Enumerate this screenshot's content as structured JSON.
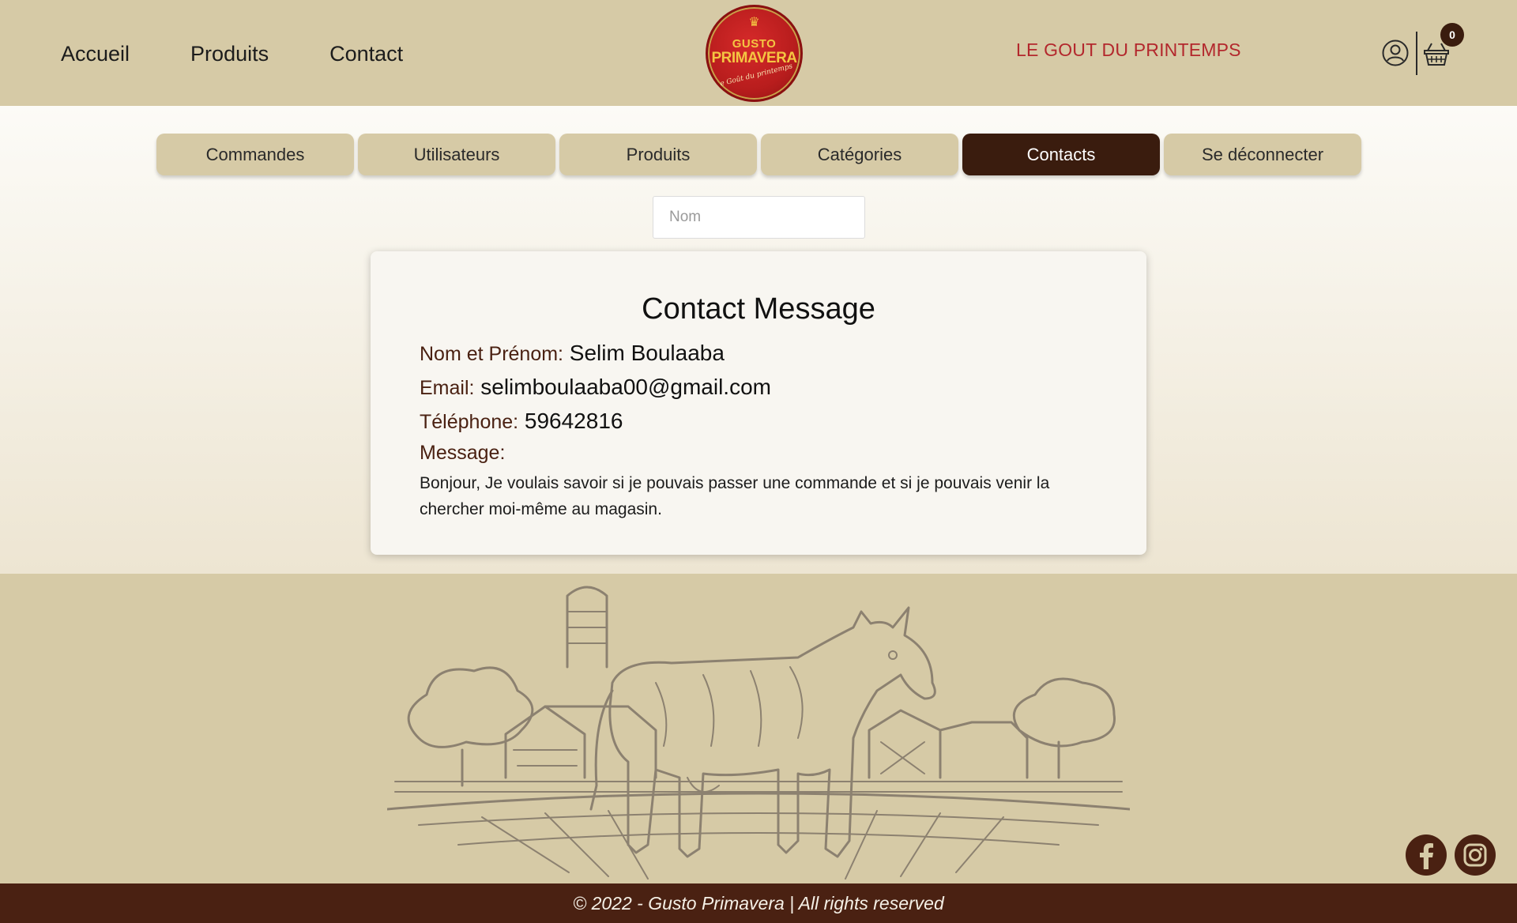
{
  "header": {
    "nav": [
      "Accueil",
      "Produits",
      "Contact"
    ],
    "logo": {
      "top": "GUSTO",
      "main": "PRIMAVERA",
      "sub": "Le Goût du printemps"
    },
    "tagline": "LE GOUT DU PRINTEMPS",
    "cart_count": "0",
    "icons": [
      "user-icon",
      "basket-icon"
    ],
    "tagline_color": "#b3282d"
  },
  "admin_tabs": {
    "items": [
      "Commandes",
      "Utilisateurs",
      "Produits",
      "Catégories",
      "Contacts",
      "Se déconnecter"
    ],
    "active": "Contacts"
  },
  "search": {
    "placeholder": "Nom",
    "value": ""
  },
  "contact_card": {
    "title": "Contact Message",
    "name_label": "Nom et Prénom:",
    "name_value": "Selim Boulaaba",
    "email_label": "Email:",
    "email_value": "selimboulaaba00@gmail.com",
    "phone_label": "Téléphone:",
    "phone_value": "59642816",
    "message_label": "Message:",
    "message_text": "Bonjour, Je voulais savoir si je pouvais passer une commande et si je pouvais venir la chercher moi-même au magasin."
  },
  "footer": {
    "social": [
      "facebook-icon",
      "instagram-icon"
    ],
    "copyright": "© 2022 - Gusto Primavera | All rights reserved"
  },
  "colors": {
    "header_bg": "#d6caa6",
    "active_tab": "#3a1c0e",
    "label_brown": "#4a2112",
    "footer_bar": "#4a2112"
  }
}
